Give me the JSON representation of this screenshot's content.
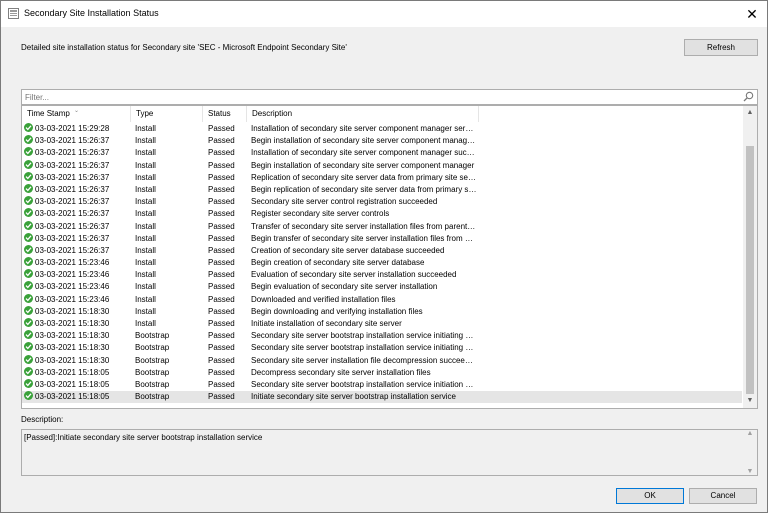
{
  "window": {
    "title": "Secondary Site Installation Status"
  },
  "header": {
    "text": "Detailed site installation status for Secondary site 'SEC - Microsoft Endpoint Secondary Site'"
  },
  "toolbar": {
    "refresh_label": "Refresh"
  },
  "filter": {
    "placeholder": "Filter..."
  },
  "table": {
    "columns": [
      "Time Stamp",
      "Type",
      "Status",
      "Description"
    ],
    "rows": [
      {
        "ts": "03-03-2021 15:29:28",
        "type": "Install",
        "status": "Passed",
        "desc": "Installation of secondary site server component manager servic..."
      },
      {
        "ts": "03-03-2021 15:26:37",
        "type": "Install",
        "status": "Passed",
        "desc": "Begin installation of secondary site server component manager ..."
      },
      {
        "ts": "03-03-2021 15:26:37",
        "type": "Install",
        "status": "Passed",
        "desc": "Installation of secondary site server component manager succe..."
      },
      {
        "ts": "03-03-2021 15:26:37",
        "type": "Install",
        "status": "Passed",
        "desc": "Begin installation of secondary site server component manager"
      },
      {
        "ts": "03-03-2021 15:26:37",
        "type": "Install",
        "status": "Passed",
        "desc": "Replication of secondary site server data from primary site serve..."
      },
      {
        "ts": "03-03-2021 15:26:37",
        "type": "Install",
        "status": "Passed",
        "desc": "Begin replication of secondary site server data from primary site ..."
      },
      {
        "ts": "03-03-2021 15:26:37",
        "type": "Install",
        "status": "Passed",
        "desc": "Secondary site server control registration succeeded"
      },
      {
        "ts": "03-03-2021 15:26:37",
        "type": "Install",
        "status": "Passed",
        "desc": "Register secondary site server controls"
      },
      {
        "ts": "03-03-2021 15:26:37",
        "type": "Install",
        "status": "Passed",
        "desc": "Transfer of secondary site server installation files from parent pri..."
      },
      {
        "ts": "03-03-2021 15:26:37",
        "type": "Install",
        "status": "Passed",
        "desc": "Begin transfer of secondary site server installation files from par..."
      },
      {
        "ts": "03-03-2021 15:26:37",
        "type": "Install",
        "status": "Passed",
        "desc": "Creation of secondary site server database succeeded"
      },
      {
        "ts": "03-03-2021 15:23:46",
        "type": "Install",
        "status": "Passed",
        "desc": "Begin creation of secondary site server database"
      },
      {
        "ts": "03-03-2021 15:23:46",
        "type": "Install",
        "status": "Passed",
        "desc": "Evaluation of secondary site server installation succeeded"
      },
      {
        "ts": "03-03-2021 15:23:46",
        "type": "Install",
        "status": "Passed",
        "desc": "Begin evaluation of secondary site server installation"
      },
      {
        "ts": "03-03-2021 15:23:46",
        "type": "Install",
        "status": "Passed",
        "desc": "Downloaded and verified installation files"
      },
      {
        "ts": "03-03-2021 15:18:30",
        "type": "Install",
        "status": "Passed",
        "desc": "Begin downloading and verifying installation files"
      },
      {
        "ts": "03-03-2021 15:18:30",
        "type": "Install",
        "status": "Passed",
        "desc": "Initiate installation of secondary site server"
      },
      {
        "ts": "03-03-2021 15:18:30",
        "type": "Bootstrap",
        "status": "Passed",
        "desc": "Secondary site server bootstrap installation service initiating set..."
      },
      {
        "ts": "03-03-2021 15:18:30",
        "type": "Bootstrap",
        "status": "Passed",
        "desc": "Secondary site server bootstrap installation service initiating setup"
      },
      {
        "ts": "03-03-2021 15:18:30",
        "type": "Bootstrap",
        "status": "Passed",
        "desc": "Secondary site server installation file decompression succeeded"
      },
      {
        "ts": "03-03-2021 15:18:05",
        "type": "Bootstrap",
        "status": "Passed",
        "desc": "Decompress secondary site server installation files"
      },
      {
        "ts": "03-03-2021 15:18:05",
        "type": "Bootstrap",
        "status": "Passed",
        "desc": "Secondary site server bootstrap installation service initiation suc..."
      },
      {
        "ts": "03-03-2021 15:18:05",
        "type": "Bootstrap",
        "status": "Passed",
        "desc": "Initiate secondary site server bootstrap installation service"
      }
    ],
    "selected_index": 22
  },
  "description": {
    "label": "Description:",
    "text": "[Passed]:Initiate secondary site server bootstrap installation service"
  },
  "buttons": {
    "ok": "OK",
    "cancel": "Cancel"
  },
  "colors": {
    "success": "#3aa13a",
    "focus_border": "#0078d7"
  }
}
